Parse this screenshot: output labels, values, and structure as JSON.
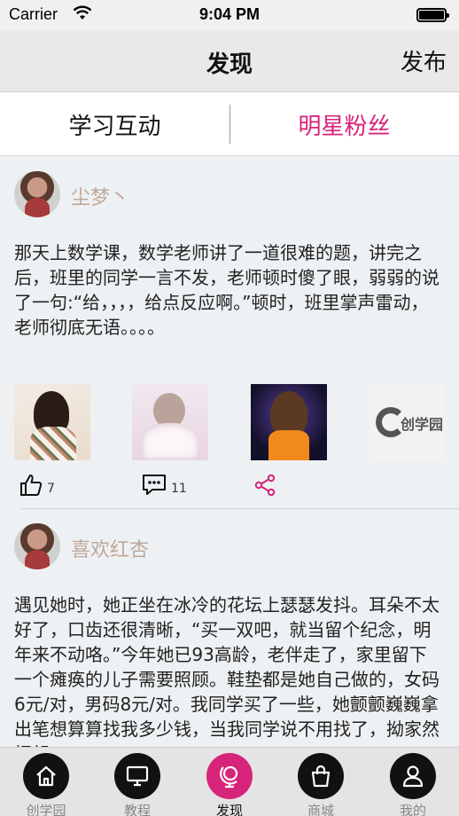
{
  "status_bar": {
    "carrier": "Carrier",
    "time": "9:04 PM"
  },
  "nav": {
    "title": "发现",
    "right_action": "发布"
  },
  "segments": {
    "left": "学习互动",
    "right": "明星粉丝",
    "selected": "明星粉丝"
  },
  "colors": {
    "accent": "#d6247a",
    "username": "#c0a898"
  },
  "posts": [
    {
      "username": "尘梦丶",
      "text": "那天上数学课，数学老师讲了一道很难的题，讲完之后，班里的同学一言不发，老师顿时傻了眼，弱弱的说了一句:“给，，，，给点反应啊。”顿时，班里掌声雷动，老师彻底无语。。。。",
      "image_labels": [
        "创学园"
      ],
      "likes": "7",
      "comments": "11"
    },
    {
      "username": "喜欢红杏",
      "text": "遇见她时，她正坐在冰冷的花坛上瑟瑟发抖。耳朵不太好了，口齿还很清晰，“买一双吧，就当留个纪念，明年来不动咯。”今年她已93高龄，老伴走了，家里留下一个瘫痪的儿子需要照顾。鞋垫都是她自己做的，女码6元/对，男码8元/对。我同学买了一些，她颤颤巍巍拿出笔想算算找我多少钱，当我同学说不用找了，拗家然拒起"
    }
  ],
  "tabbar": {
    "items": [
      {
        "label": "创学园",
        "icon": "home-icon"
      },
      {
        "label": "教程",
        "icon": "monitor-icon"
      },
      {
        "label": "发现",
        "icon": "globe-icon"
      },
      {
        "label": "商城",
        "icon": "shopping-bag-icon"
      },
      {
        "label": "我的",
        "icon": "user-icon"
      }
    ],
    "active": "发现"
  }
}
